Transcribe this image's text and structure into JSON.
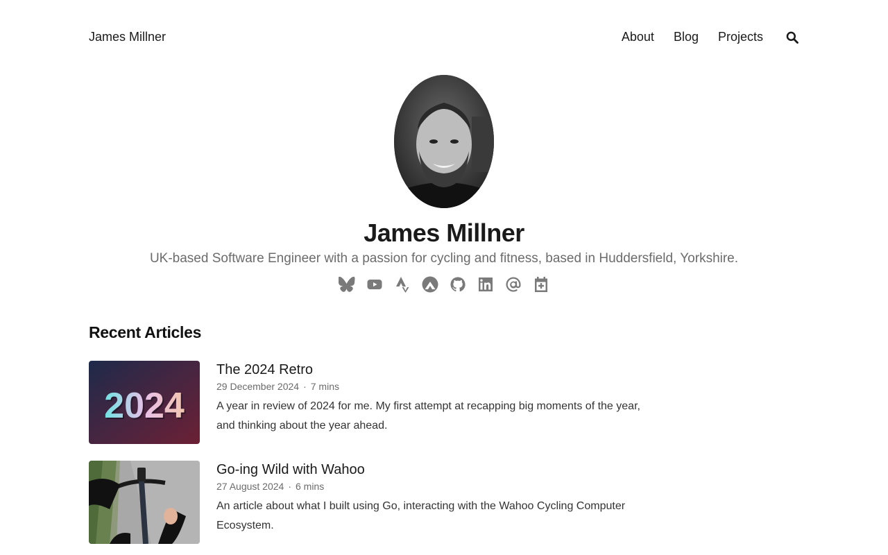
{
  "header": {
    "site_title": "James Millner",
    "nav": [
      {
        "label": "About"
      },
      {
        "label": "Blog"
      },
      {
        "label": "Projects"
      }
    ],
    "search_icon": "search-icon"
  },
  "hero": {
    "name": "James Millner",
    "tagline": "UK-based Software Engineer with a passion for cycling and fitness, based in Huddersfield, Yorkshire.",
    "social_icons": [
      "bluesky-icon",
      "youtube-icon",
      "strava-icon",
      "komoot-icon",
      "github-icon",
      "linkedin-icon",
      "email-icon",
      "calendar-icon"
    ]
  },
  "recent": {
    "heading": "Recent Articles",
    "articles": [
      {
        "title": "The 2024 Retro",
        "date": "29 December 2024",
        "read_time": "7 mins",
        "description": "A year in review of 2024 for me. My first attempt at recapping big moments of the year, and thinking about the year ahead.",
        "thumb_text": "2024"
      },
      {
        "title": "Go-ing Wild with Wahoo",
        "date": "27 August 2024",
        "read_time": "6 mins",
        "description": "An article about what I built using Go, interacting with the Wahoo Cycling Computer Ecosystem."
      }
    ]
  },
  "colors": {
    "text": "#1a1a1a",
    "muted": "#6b6b6b",
    "icon": "#7a7a7a"
  }
}
